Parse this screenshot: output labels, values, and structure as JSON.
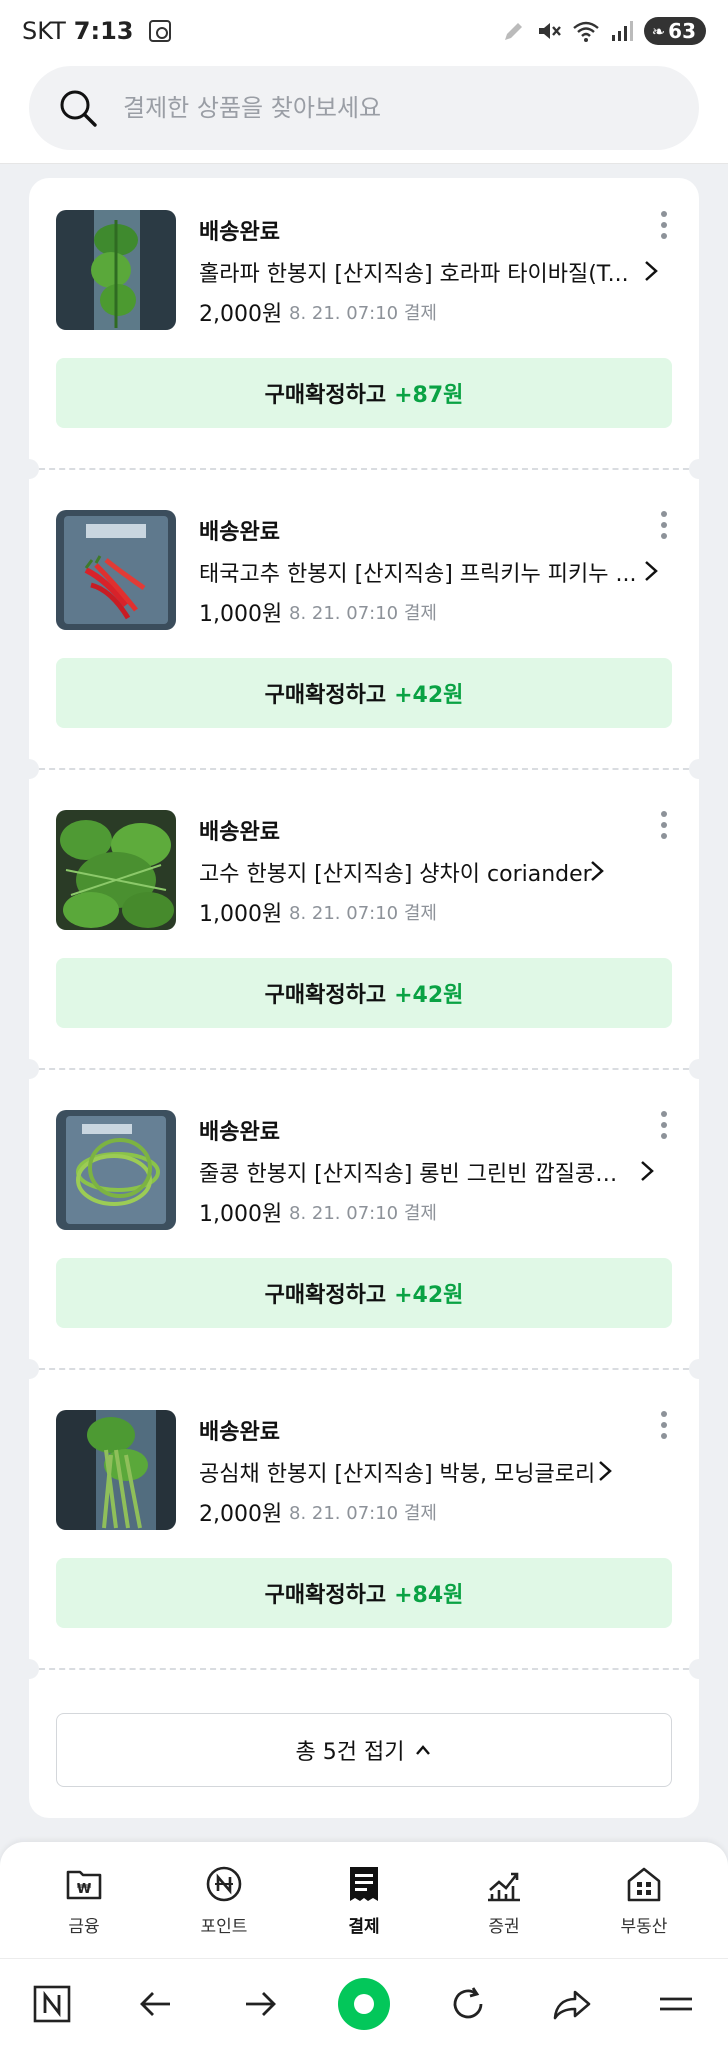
{
  "status_bar": {
    "carrier": "SKT",
    "time": "7:13",
    "battery": "63"
  },
  "search": {
    "placeholder": "결제한 상품을 찾아보세요"
  },
  "orders": [
    {
      "status": "배송완료",
      "name": "홀라파 한봉지 [산지직송] 호라파 타이바질(T...",
      "price": "2,000원",
      "date": "8. 21. 07:10 결제",
      "confirm_label": "구매확정하고",
      "confirm_points": "+87원"
    },
    {
      "status": "배송완료",
      "name": "태국고추 한봉지 [산지직송] 프릭키누 피키누 ...",
      "price": "1,000원",
      "date": "8. 21. 07:10 결제",
      "confirm_label": "구매확정하고",
      "confirm_points": "+42원"
    },
    {
      "status": "배송완료",
      "name": "고수 한봉지 [산지직송] 샹차이 coriander",
      "price": "1,000원",
      "date": "8. 21. 07:10 결제",
      "confirm_label": "구매확정하고",
      "confirm_points": "+42원"
    },
    {
      "status": "배송완료",
      "name": "줄콩 한봉지 [산지직송] 롱빈 그린빈 깝질콩 ...",
      "price": "1,000원",
      "date": "8. 21. 07:10 결제",
      "confirm_label": "구매확정하고",
      "confirm_points": "+42원"
    },
    {
      "status": "배송완료",
      "name": "공심채 한봉지 [산지직송] 박붕, 모닝글로리",
      "price": "2,000원",
      "date": "8. 21. 07:10 결제",
      "confirm_label": "구매확정하고",
      "confirm_points": "+84원"
    }
  ],
  "collapse": {
    "label": "총 5건 접기"
  },
  "tabs": [
    {
      "label": "금융",
      "icon": "finance-folder-icon"
    },
    {
      "label": "포인트",
      "icon": "npoint-icon"
    },
    {
      "label": "결제",
      "icon": "payment-receipt-icon"
    },
    {
      "label": "증권",
      "icon": "stock-chart-icon"
    },
    {
      "label": "부동산",
      "icon": "real-estate-icon"
    }
  ],
  "colors": {
    "accent_green": "#0aa244",
    "confirm_bg": "#e0f8e6",
    "naver_green": "#03c75a"
  }
}
